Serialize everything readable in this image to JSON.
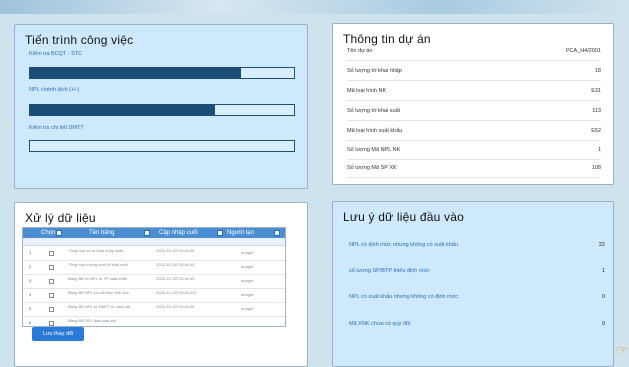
{
  "progress_panel": {
    "title": "Tiến trình công việc",
    "tasks": [
      {
        "label": "Kiểm tra BCQT - STC",
        "progress": 0.8
      },
      {
        "label": "NPL chênh lệch (+/-)",
        "progress": 0.7
      },
      {
        "label": "Kiểm tra chi tiết DMTT",
        "progress": 0.0
      }
    ]
  },
  "project_panel": {
    "title": "Thông tin dự án",
    "rows": [
      {
        "key": "Tên dự án",
        "value": "PCA_H4/2001"
      },
      {
        "key": "Số lượng tờ khai nhập",
        "value": "18"
      },
      {
        "key": "Mã loại hình NK",
        "value": "E31"
      },
      {
        "key": "Số lượng tờ khai xuất",
        "value": "113"
      },
      {
        "key": "Mã loại hình xuất khẩu",
        "value": "E52"
      },
      {
        "key": "Số lượng Mã NPL NK",
        "value": "1"
      },
      {
        "key": "Số lượng Mã SP XK",
        "value": "108"
      }
    ]
  },
  "processing_panel": {
    "title": "Xử lý dữ liệu",
    "columns": [
      "Chọn",
      "Tên bảng",
      "Cập nhập cuối",
      "Người tạo"
    ],
    "rows": [
      {
        "no": "1",
        "name": "Tổng hợp số tờ khai nhập khẩu",
        "date": "2022-10-19T15:42:45",
        "user": "dungnt"
      },
      {
        "no": "2",
        "name": "Tổng hợp lượng xuất tờ khai xuất",
        "date": "2022-10-19T15:42:45",
        "user": "dungnt"
      },
      {
        "no": "3",
        "name": "Bảng BĐ từ NPL tờ TP xuất khẩu",
        "date": "2022-10-19T15:42:45",
        "user": "dungnt"
      },
      {
        "no": "4",
        "name": "Bảng BĐ NPL có mã theo lĩnh vực",
        "date": "2022-10-19T15:44:221",
        "user": "dungnt"
      },
      {
        "no": "5",
        "name": "Bảng BĐ NPL tờ ĐMTT tờ cách đã",
        "date": "2022-10-19T15:42:45",
        "user": "dungnt"
      },
      {
        "no": "6",
        "name": "Bảng BĐ NPL theo loại mã",
        "date": "",
        "user": ""
      }
    ],
    "save_label": "Lưu thay đổi"
  },
  "notes_panel": {
    "title": "Lưu ý dữ liệu đầu vào",
    "rows": [
      {
        "label": "NPL có định mức nhưng không có xuất khẩu",
        "value": "22"
      },
      {
        "label": "số lượng SP/BTP thiếu định mức",
        "value": "1"
      },
      {
        "label": "NPL có xuất khẩu nhưng không có định mức",
        "value": "0"
      },
      {
        "label": "Mã XNK chưa có quy đổi",
        "value": "0"
      }
    ]
  },
  "colors": {
    "panel_blue": "#cde9fb",
    "bar_fill": "#1a4e77",
    "header_blue": "#4b8fd2",
    "link_blue": "#2d6fb5",
    "button_blue": "#2a7ad8"
  }
}
